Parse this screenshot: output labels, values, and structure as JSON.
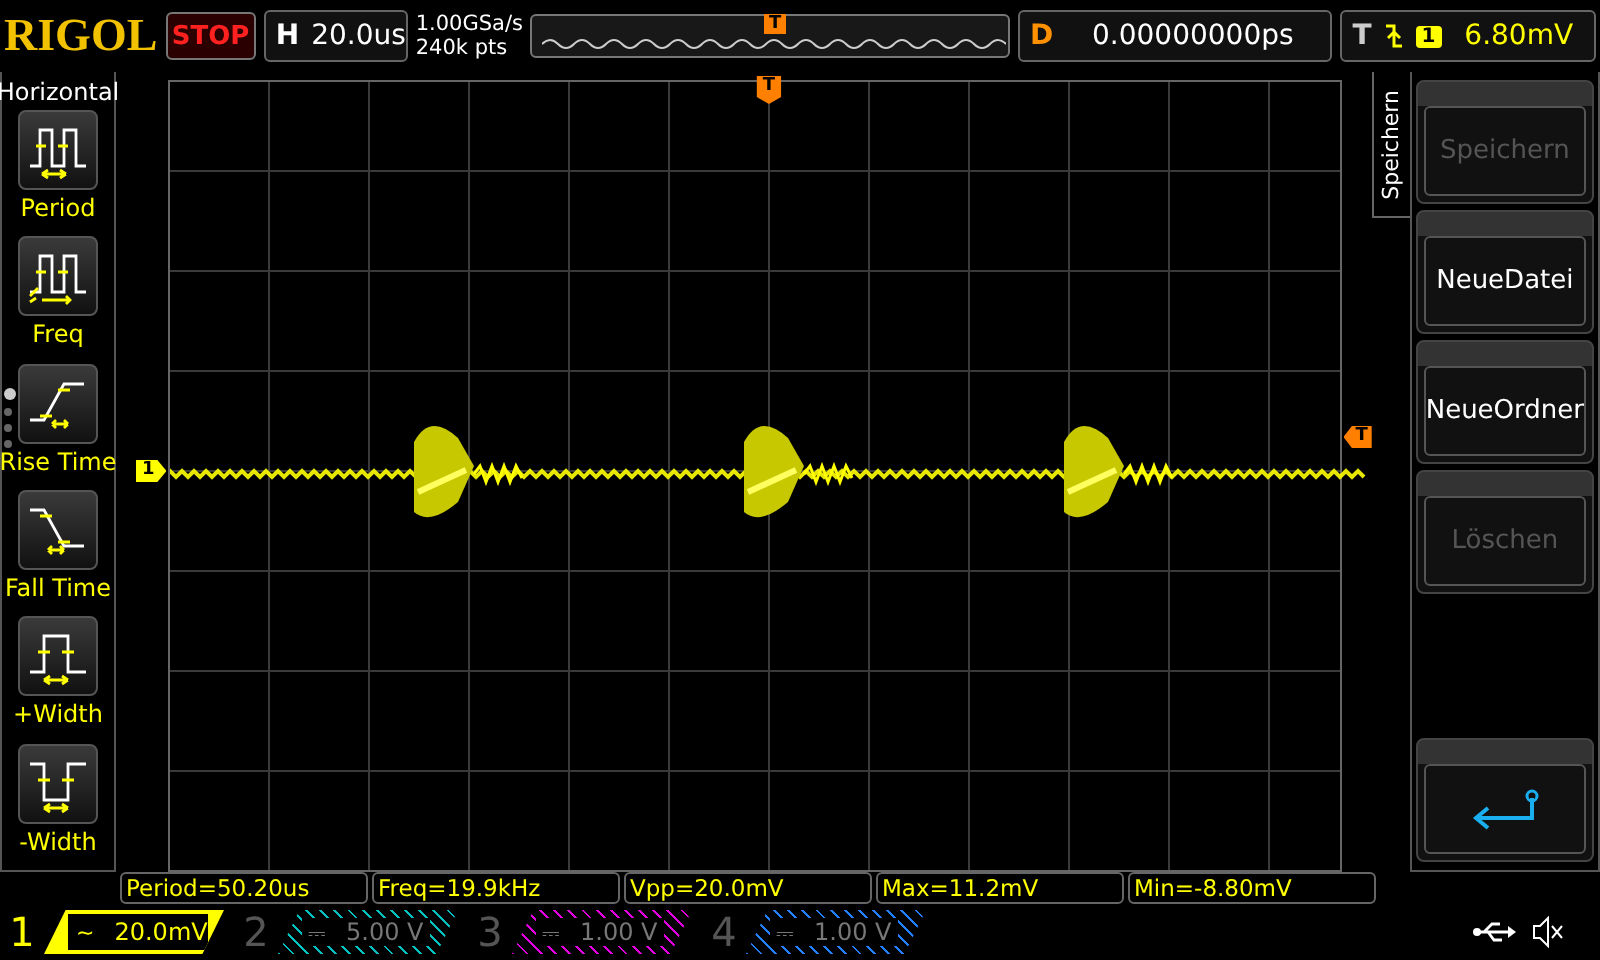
{
  "top_bar": {
    "logo": "RIGOL",
    "run_state": "STOP",
    "horizontal": {
      "label": "H",
      "value": "20.0us"
    },
    "sample_rate": "1.00GSa/s",
    "memory_depth": "240k pts",
    "memory_marker": "T",
    "delay": {
      "label": "D",
      "value": "0.00000000ps"
    },
    "trigger": {
      "label": "T",
      "source": "1",
      "level": "6.80mV"
    }
  },
  "left_menu": {
    "title": "Horizontal",
    "items": [
      {
        "kind": "period",
        "label": "Period"
      },
      {
        "kind": "freq",
        "label": "Freq"
      },
      {
        "kind": "rise",
        "label": "Rise Time"
      },
      {
        "kind": "fall",
        "label": "Fall Time"
      },
      {
        "kind": "pwidth",
        "label": "+Width"
      },
      {
        "kind": "nwidth",
        "label": "-Width"
      }
    ],
    "pages": [
      {
        "selected": true
      },
      {
        "selected": false
      },
      {
        "selected": false
      },
      {
        "selected": false
      }
    ]
  },
  "screen": {
    "channel_marker": "1",
    "trigger_position_marker": "T",
    "trigger_level_marker": "T"
  },
  "right_menu": {
    "tab": "Speichern",
    "buttons": [
      {
        "kind": "text",
        "label": "Speichern",
        "disabled": true
      },
      {
        "kind": "text",
        "label": "NeueDatei",
        "disabled": false
      },
      {
        "kind": "text",
        "label": "NeueOrdner",
        "disabled": false
      },
      {
        "kind": "text",
        "label": "Löschen",
        "disabled": true
      },
      {
        "kind": "back",
        "disabled": false
      }
    ]
  },
  "measurements": [
    "Period=50.20us",
    "Freq=19.9kHz",
    "Vpp=20.0mV",
    "Max=11.2mV",
    "Min=-8.80mV"
  ],
  "channels": [
    {
      "number": "1",
      "coupling": "~",
      "scale": "20.0mV",
      "color": "#ffff00",
      "on": true
    },
    {
      "number": "2",
      "coupling": "⎓",
      "scale": "5.00 V",
      "color": "#00c0c0",
      "on": false
    },
    {
      "number": "3",
      "coupling": "⎓",
      "scale": "1.00 V",
      "color": "#e000e0",
      "on": false
    },
    {
      "number": "4",
      "coupling": "⎓",
      "scale": "1.00 V",
      "color": "#2080ff",
      "on": false
    }
  ]
}
